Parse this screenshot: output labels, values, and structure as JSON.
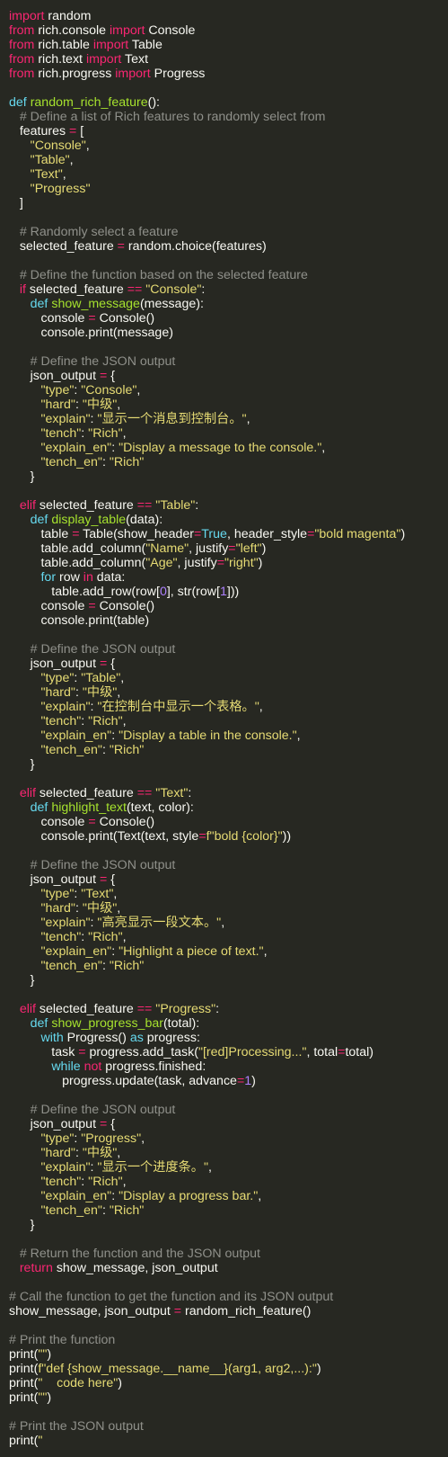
{
  "theme": {
    "background": "#272822",
    "text": "#f8f8f2",
    "keyword": "#f92672",
    "keyword_blue": "#66d9ef",
    "function": "#a6e22e",
    "string": "#e6db74",
    "number": "#ae81ff",
    "comment": "#8f908a"
  },
  "code": [
    [
      [
        "kw",
        "import"
      ],
      [
        "pl",
        " random"
      ]
    ],
    [
      [
        "kw",
        "from"
      ],
      [
        "pl",
        " rich.console "
      ],
      [
        "kw",
        "import"
      ],
      [
        "pl",
        " Console"
      ]
    ],
    [
      [
        "kw",
        "from"
      ],
      [
        "pl",
        " rich.table "
      ],
      [
        "kw",
        "import"
      ],
      [
        "pl",
        " Table"
      ]
    ],
    [
      [
        "kw",
        "from"
      ],
      [
        "pl",
        " rich.text "
      ],
      [
        "kw",
        "import"
      ],
      [
        "pl",
        " Text"
      ]
    ],
    [
      [
        "kw",
        "from"
      ],
      [
        "pl",
        " rich.progress "
      ],
      [
        "kw",
        "import"
      ],
      [
        "pl",
        " Progress"
      ]
    ],
    [],
    [
      [
        "kwb",
        "def"
      ],
      [
        "pl",
        " "
      ],
      [
        "fn",
        "random_rich_feature"
      ],
      [
        "pl",
        "():"
      ]
    ],
    [
      [
        "pl",
        "   "
      ],
      [
        "cm",
        "# Define a list of Rich features to randomly select from"
      ]
    ],
    [
      [
        "pl",
        "   features "
      ],
      [
        "kw",
        "="
      ],
      [
        "pl",
        " ["
      ]
    ],
    [
      [
        "pl",
        "      "
      ],
      [
        "str",
        "\"Console\""
      ],
      [
        "pl",
        ","
      ]
    ],
    [
      [
        "pl",
        "      "
      ],
      [
        "str",
        "\"Table\""
      ],
      [
        "pl",
        ","
      ]
    ],
    [
      [
        "pl",
        "      "
      ],
      [
        "str",
        "\"Text\""
      ],
      [
        "pl",
        ","
      ]
    ],
    [
      [
        "pl",
        "      "
      ],
      [
        "str",
        "\"Progress\""
      ]
    ],
    [
      [
        "pl",
        "   ]"
      ]
    ],
    [],
    [
      [
        "pl",
        "   "
      ],
      [
        "cm",
        "# Randomly select a feature"
      ]
    ],
    [
      [
        "pl",
        "   selected_feature "
      ],
      [
        "kw",
        "="
      ],
      [
        "pl",
        " random.choice(features)"
      ]
    ],
    [],
    [
      [
        "pl",
        "   "
      ],
      [
        "cm",
        "# Define the function based on the selected feature"
      ]
    ],
    [
      [
        "pl",
        "   "
      ],
      [
        "kw",
        "if"
      ],
      [
        "pl",
        " selected_feature "
      ],
      [
        "kw",
        "=="
      ],
      [
        "pl",
        " "
      ],
      [
        "str",
        "\"Console\""
      ],
      [
        "pl",
        ":"
      ]
    ],
    [
      [
        "pl",
        "      "
      ],
      [
        "kwb",
        "def"
      ],
      [
        "pl",
        " "
      ],
      [
        "fn",
        "show_message"
      ],
      [
        "pl",
        "(message):"
      ]
    ],
    [
      [
        "pl",
        "         console "
      ],
      [
        "kw",
        "="
      ],
      [
        "pl",
        " Console()"
      ]
    ],
    [
      [
        "pl",
        "         console.print(message)"
      ]
    ],
    [],
    [
      [
        "pl",
        "      "
      ],
      [
        "cm",
        "# Define the JSON output"
      ]
    ],
    [
      [
        "pl",
        "      json_output "
      ],
      [
        "kw",
        "="
      ],
      [
        "pl",
        " {"
      ]
    ],
    [
      [
        "pl",
        "         "
      ],
      [
        "str",
        "\"type\""
      ],
      [
        "pl",
        ": "
      ],
      [
        "str",
        "\"Console\""
      ],
      [
        "pl",
        ","
      ]
    ],
    [
      [
        "pl",
        "         "
      ],
      [
        "str",
        "\"hard\""
      ],
      [
        "pl",
        ": "
      ],
      [
        "str",
        "\"中级\""
      ],
      [
        "pl",
        ","
      ]
    ],
    [
      [
        "pl",
        "         "
      ],
      [
        "str",
        "\"explain\""
      ],
      [
        "pl",
        ": "
      ],
      [
        "str",
        "\"显示一个消息到控制台。\""
      ],
      [
        "pl",
        ","
      ]
    ],
    [
      [
        "pl",
        "         "
      ],
      [
        "str",
        "\"tench\""
      ],
      [
        "pl",
        ": "
      ],
      [
        "str",
        "\"Rich\""
      ],
      [
        "pl",
        ","
      ]
    ],
    [
      [
        "pl",
        "         "
      ],
      [
        "str",
        "\"explain_en\""
      ],
      [
        "pl",
        ": "
      ],
      [
        "str",
        "\"Display a message to the console.\""
      ],
      [
        "pl",
        ","
      ]
    ],
    [
      [
        "pl",
        "         "
      ],
      [
        "str",
        "\"tench_en\""
      ],
      [
        "pl",
        ": "
      ],
      [
        "str",
        "\"Rich\""
      ]
    ],
    [
      [
        "pl",
        "      }"
      ]
    ],
    [],
    [
      [
        "pl",
        "   "
      ],
      [
        "kw",
        "elif"
      ],
      [
        "pl",
        " selected_feature "
      ],
      [
        "kw",
        "=="
      ],
      [
        "pl",
        " "
      ],
      [
        "str",
        "\"Table\""
      ],
      [
        "pl",
        ":"
      ]
    ],
    [
      [
        "pl",
        "      "
      ],
      [
        "kwb",
        "def"
      ],
      [
        "pl",
        " "
      ],
      [
        "fn",
        "display_table"
      ],
      [
        "pl",
        "(data):"
      ]
    ],
    [
      [
        "pl",
        "         table "
      ],
      [
        "kw",
        "="
      ],
      [
        "pl",
        " Table(show_header"
      ],
      [
        "kw",
        "="
      ],
      [
        "kwb",
        "True"
      ],
      [
        "pl",
        ", header_style"
      ],
      [
        "kw",
        "="
      ],
      [
        "str",
        "\"bold magenta\""
      ],
      [
        "pl",
        ")"
      ]
    ],
    [
      [
        "pl",
        "         table.add_column("
      ],
      [
        "str",
        "\"Name\""
      ],
      [
        "pl",
        ", justify"
      ],
      [
        "kw",
        "="
      ],
      [
        "str",
        "\"left\""
      ],
      [
        "pl",
        ")"
      ]
    ],
    [
      [
        "pl",
        "         table.add_column("
      ],
      [
        "str",
        "\"Age\""
      ],
      [
        "pl",
        ", justify"
      ],
      [
        "kw",
        "="
      ],
      [
        "str",
        "\"right\""
      ],
      [
        "pl",
        ")"
      ]
    ],
    [
      [
        "pl",
        "         "
      ],
      [
        "kwb",
        "for"
      ],
      [
        "pl",
        " row "
      ],
      [
        "kw",
        "in"
      ],
      [
        "pl",
        " data:"
      ]
    ],
    [
      [
        "pl",
        "            table.add_row(row["
      ],
      [
        "num",
        "0"
      ],
      [
        "pl",
        "], str(row["
      ],
      [
        "num",
        "1"
      ],
      [
        "pl",
        "]))"
      ]
    ],
    [
      [
        "pl",
        "         console "
      ],
      [
        "kw",
        "="
      ],
      [
        "pl",
        " Console()"
      ]
    ],
    [
      [
        "pl",
        "         console.print(table)"
      ]
    ],
    [],
    [
      [
        "pl",
        "      "
      ],
      [
        "cm",
        "# Define the JSON output"
      ]
    ],
    [
      [
        "pl",
        "      json_output "
      ],
      [
        "kw",
        "="
      ],
      [
        "pl",
        " {"
      ]
    ],
    [
      [
        "pl",
        "         "
      ],
      [
        "str",
        "\"type\""
      ],
      [
        "pl",
        ": "
      ],
      [
        "str",
        "\"Table\""
      ],
      [
        "pl",
        ","
      ]
    ],
    [
      [
        "pl",
        "         "
      ],
      [
        "str",
        "\"hard\""
      ],
      [
        "pl",
        ": "
      ],
      [
        "str",
        "\"中级\""
      ],
      [
        "pl",
        ","
      ]
    ],
    [
      [
        "pl",
        "         "
      ],
      [
        "str",
        "\"explain\""
      ],
      [
        "pl",
        ": "
      ],
      [
        "str",
        "\"在控制台中显示一个表格。\""
      ],
      [
        "pl",
        ","
      ]
    ],
    [
      [
        "pl",
        "         "
      ],
      [
        "str",
        "\"tench\""
      ],
      [
        "pl",
        ": "
      ],
      [
        "str",
        "\"Rich\""
      ],
      [
        "pl",
        ","
      ]
    ],
    [
      [
        "pl",
        "         "
      ],
      [
        "str",
        "\"explain_en\""
      ],
      [
        "pl",
        ": "
      ],
      [
        "str",
        "\"Display a table in the console.\""
      ],
      [
        "pl",
        ","
      ]
    ],
    [
      [
        "pl",
        "         "
      ],
      [
        "str",
        "\"tench_en\""
      ],
      [
        "pl",
        ": "
      ],
      [
        "str",
        "\"Rich\""
      ]
    ],
    [
      [
        "pl",
        "      }"
      ]
    ],
    [],
    [
      [
        "pl",
        "   "
      ],
      [
        "kw",
        "elif"
      ],
      [
        "pl",
        " selected_feature "
      ],
      [
        "kw",
        "=="
      ],
      [
        "pl",
        " "
      ],
      [
        "str",
        "\"Text\""
      ],
      [
        "pl",
        ":"
      ]
    ],
    [
      [
        "pl",
        "      "
      ],
      [
        "kwb",
        "def"
      ],
      [
        "pl",
        " "
      ],
      [
        "fn",
        "highlight_text"
      ],
      [
        "pl",
        "(text, color):"
      ]
    ],
    [
      [
        "pl",
        "         console "
      ],
      [
        "kw",
        "="
      ],
      [
        "pl",
        " Console()"
      ]
    ],
    [
      [
        "pl",
        "         console.print(Text(text, style"
      ],
      [
        "kw",
        "="
      ],
      [
        "str",
        "f\"bold {color}\""
      ],
      [
        "pl",
        "))"
      ]
    ],
    [],
    [
      [
        "pl",
        "      "
      ],
      [
        "cm",
        "# Define the JSON output"
      ]
    ],
    [
      [
        "pl",
        "      json_output "
      ],
      [
        "kw",
        "="
      ],
      [
        "pl",
        " {"
      ]
    ],
    [
      [
        "pl",
        "         "
      ],
      [
        "str",
        "\"type\""
      ],
      [
        "pl",
        ": "
      ],
      [
        "str",
        "\"Text\""
      ],
      [
        "pl",
        ","
      ]
    ],
    [
      [
        "pl",
        "         "
      ],
      [
        "str",
        "\"hard\""
      ],
      [
        "pl",
        ": "
      ],
      [
        "str",
        "\"中级\""
      ],
      [
        "pl",
        ","
      ]
    ],
    [
      [
        "pl",
        "         "
      ],
      [
        "str",
        "\"explain\""
      ],
      [
        "pl",
        ": "
      ],
      [
        "str",
        "\"高亮显示一段文本。\""
      ],
      [
        "pl",
        ","
      ]
    ],
    [
      [
        "pl",
        "         "
      ],
      [
        "str",
        "\"tench\""
      ],
      [
        "pl",
        ": "
      ],
      [
        "str",
        "\"Rich\""
      ],
      [
        "pl",
        ","
      ]
    ],
    [
      [
        "pl",
        "         "
      ],
      [
        "str",
        "\"explain_en\""
      ],
      [
        "pl",
        ": "
      ],
      [
        "str",
        "\"Highlight a piece of text.\""
      ],
      [
        "pl",
        ","
      ]
    ],
    [
      [
        "pl",
        "         "
      ],
      [
        "str",
        "\"tench_en\""
      ],
      [
        "pl",
        ": "
      ],
      [
        "str",
        "\"Rich\""
      ]
    ],
    [
      [
        "pl",
        "      }"
      ]
    ],
    [],
    [
      [
        "pl",
        "   "
      ],
      [
        "kw",
        "elif"
      ],
      [
        "pl",
        " selected_feature "
      ],
      [
        "kw",
        "=="
      ],
      [
        "pl",
        " "
      ],
      [
        "str",
        "\"Progress\""
      ],
      [
        "pl",
        ":"
      ]
    ],
    [
      [
        "pl",
        "      "
      ],
      [
        "kwb",
        "def"
      ],
      [
        "pl",
        " "
      ],
      [
        "fn",
        "show_progress_bar"
      ],
      [
        "pl",
        "(total):"
      ]
    ],
    [
      [
        "pl",
        "         "
      ],
      [
        "kwb",
        "with"
      ],
      [
        "pl",
        " Progress() "
      ],
      [
        "kwb",
        "as"
      ],
      [
        "pl",
        " progress:"
      ]
    ],
    [
      [
        "pl",
        "            task "
      ],
      [
        "kw",
        "="
      ],
      [
        "pl",
        " progress.add_task("
      ],
      [
        "str",
        "\"[red]Processing...\""
      ],
      [
        "pl",
        ", total"
      ],
      [
        "kw",
        "="
      ],
      [
        "pl",
        "total)"
      ]
    ],
    [
      [
        "pl",
        "            "
      ],
      [
        "kwb",
        "while"
      ],
      [
        "pl",
        " "
      ],
      [
        "kw",
        "not"
      ],
      [
        "pl",
        " progress.finished:"
      ]
    ],
    [
      [
        "pl",
        "               progress.update(task, advance"
      ],
      [
        "kw",
        "="
      ],
      [
        "num",
        "1"
      ],
      [
        "pl",
        ")"
      ]
    ],
    [],
    [
      [
        "pl",
        "      "
      ],
      [
        "cm",
        "# Define the JSON output"
      ]
    ],
    [
      [
        "pl",
        "      json_output "
      ],
      [
        "kw",
        "="
      ],
      [
        "pl",
        " {"
      ]
    ],
    [
      [
        "pl",
        "         "
      ],
      [
        "str",
        "\"type\""
      ],
      [
        "pl",
        ": "
      ],
      [
        "str",
        "\"Progress\""
      ],
      [
        "pl",
        ","
      ]
    ],
    [
      [
        "pl",
        "         "
      ],
      [
        "str",
        "\"hard\""
      ],
      [
        "pl",
        ": "
      ],
      [
        "str",
        "\"中级\""
      ],
      [
        "pl",
        ","
      ]
    ],
    [
      [
        "pl",
        "         "
      ],
      [
        "str",
        "\"explain\""
      ],
      [
        "pl",
        ": "
      ],
      [
        "str",
        "\"显示一个进度条。\""
      ],
      [
        "pl",
        ","
      ]
    ],
    [
      [
        "pl",
        "         "
      ],
      [
        "str",
        "\"tench\""
      ],
      [
        "pl",
        ": "
      ],
      [
        "str",
        "\"Rich\""
      ],
      [
        "pl",
        ","
      ]
    ],
    [
      [
        "pl",
        "         "
      ],
      [
        "str",
        "\"explain_en\""
      ],
      [
        "pl",
        ": "
      ],
      [
        "str",
        "\"Display a progress bar.\""
      ],
      [
        "pl",
        ","
      ]
    ],
    [
      [
        "pl",
        "         "
      ],
      [
        "str",
        "\"tench_en\""
      ],
      [
        "pl",
        ": "
      ],
      [
        "str",
        "\"Rich\""
      ]
    ],
    [
      [
        "pl",
        "      }"
      ]
    ],
    [],
    [
      [
        "pl",
        "   "
      ],
      [
        "cm",
        "# Return the function and the JSON output"
      ]
    ],
    [
      [
        "pl",
        "   "
      ],
      [
        "kw",
        "return"
      ],
      [
        "pl",
        " show_message, json_output"
      ]
    ],
    [],
    [
      [
        "cm",
        "# Call the function to get the function and its JSON output"
      ]
    ],
    [
      [
        "pl",
        "show_message, json_output "
      ],
      [
        "kw",
        "="
      ],
      [
        "pl",
        " random_rich_feature()"
      ]
    ],
    [],
    [
      [
        "cm",
        "# Print the function"
      ]
    ],
    [
      [
        "pl",
        "print("
      ],
      [
        "str",
        "\"\""
      ],
      [
        "pl",
        ")"
      ]
    ],
    [
      [
        "pl",
        "print("
      ],
      [
        "str",
        "f\"def {show_message.__name__}(arg1, arg2,...):\""
      ],
      [
        "pl",
        ")"
      ]
    ],
    [
      [
        "pl",
        "print("
      ],
      [
        "str",
        "\"    code here\""
      ],
      [
        "pl",
        ")"
      ]
    ],
    [
      [
        "pl",
        "print("
      ],
      [
        "str",
        "\"\""
      ],
      [
        "pl",
        ")"
      ]
    ],
    [],
    [
      [
        "cm",
        "# Print the JSON output"
      ]
    ],
    [
      [
        "pl",
        "print("
      ],
      [
        "str",
        "\""
      ]
    ]
  ]
}
